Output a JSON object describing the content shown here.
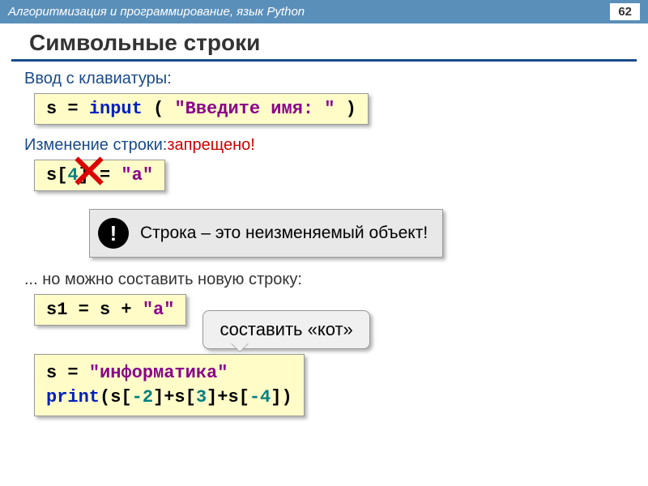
{
  "header": {
    "breadcrumb": "Алгоритмизация и программирование, язык Python",
    "page": "62"
  },
  "title": "Символьные строки",
  "section1": {
    "label": "Ввод с клавиатуры:",
    "code": {
      "p1": "s = ",
      "fn": "input",
      "p2": " ( ",
      "str": "\"Введите имя: \"",
      "p3": " )"
    }
  },
  "section2": {
    "label_pre": "Изменение строки:",
    "label_forbidden": "запрещено!",
    "code": {
      "p1": "s[",
      "idx": "4",
      "p2": "] = ",
      "str": "\"a\""
    }
  },
  "callout": {
    "badge": "!",
    "text": "Строка – это неизменяемый объект!"
  },
  "section3": {
    "label": "... но можно составить новую строку:",
    "code1": {
      "p1": "s1 = s + ",
      "str": "\"a\""
    },
    "speech": "составить «кот»",
    "code2": {
      "l1a": "s = ",
      "l1str": "\"информатика\"",
      "l2fn": "print",
      "l2a": "(s[",
      "n1": "-2",
      "l2b": "]+s[",
      "n2": "3",
      "l2c": "]+s[",
      "n3": "-4",
      "l2d": "])"
    }
  }
}
